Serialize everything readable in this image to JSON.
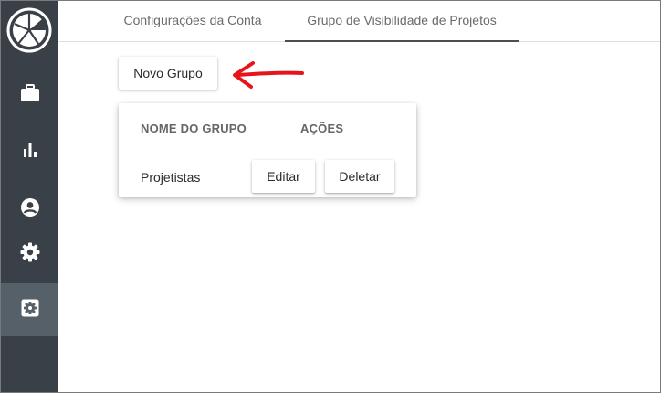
{
  "tabs": [
    {
      "label": "Configurações da Conta"
    },
    {
      "label": "Grupo de Visibilidade de Projetos",
      "active": true
    }
  ],
  "toolbar": {
    "new_group_label": "Novo Grupo"
  },
  "table": {
    "columns": [
      "NOME DO GRUPO",
      "AÇÕES"
    ],
    "rows": [
      {
        "name": "Projetistas",
        "edit_label": "Editar",
        "delete_label": "Deletar"
      }
    ]
  },
  "sidebar": {
    "icons": [
      "logo-icon",
      "briefcase-icon",
      "bar-chart-icon",
      "account-circle-icon",
      "settings-icon",
      "settings-applications-icon"
    ],
    "active": "settings-applications-icon"
  },
  "colors": {
    "sidebar_bg": "#3a4047",
    "sidebar_active": "#566069",
    "annotation_arrow": "#e8141c"
  }
}
